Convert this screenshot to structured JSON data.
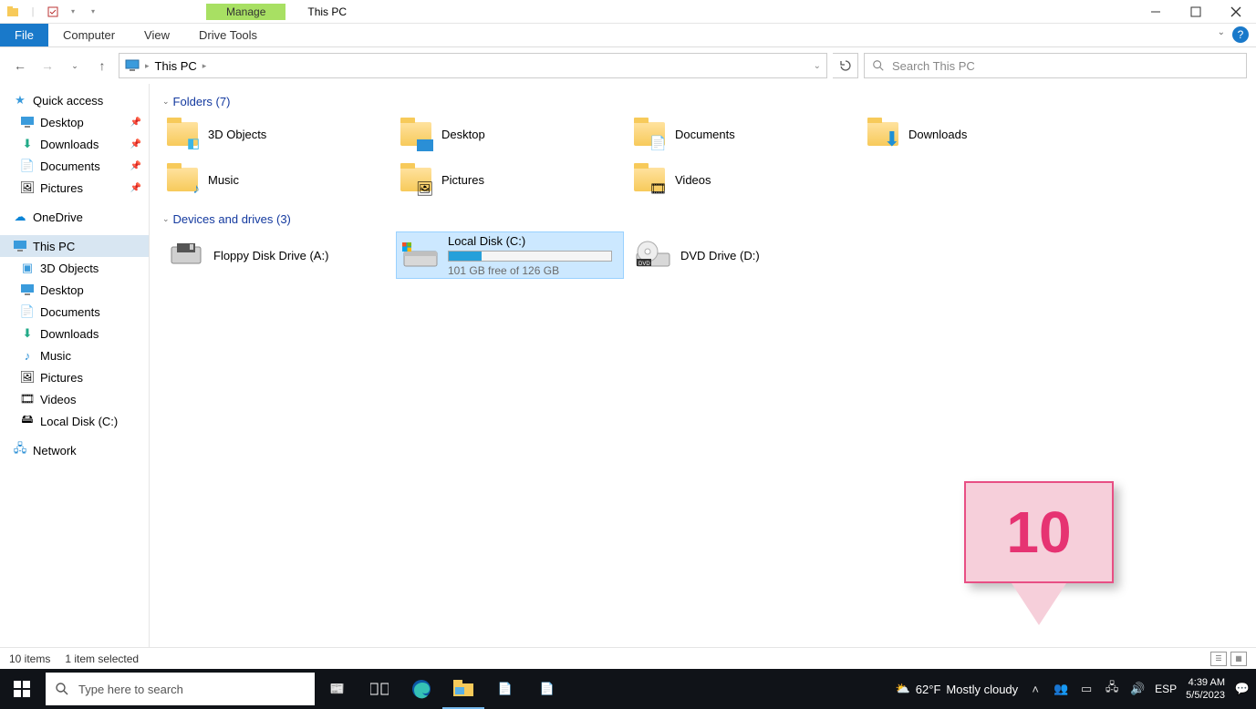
{
  "window": {
    "contextual_tab": "Manage",
    "contextual_group": "Drive Tools",
    "title": "This PC"
  },
  "ribbon": {
    "tabs": {
      "file": "File",
      "computer": "Computer",
      "view": "View",
      "drive_tools": "Drive Tools"
    }
  },
  "breadcrumb": {
    "root": "This PC"
  },
  "search": {
    "placeholder": "Search This PC"
  },
  "sidebar": {
    "quick_access": "Quick access",
    "quick": {
      "desktop": "Desktop",
      "downloads": "Downloads",
      "documents": "Documents",
      "pictures": "Pictures"
    },
    "onedrive": "OneDrive",
    "this_pc": "This PC",
    "pc": {
      "objects3d": "3D Objects",
      "desktop": "Desktop",
      "documents": "Documents",
      "downloads": "Downloads",
      "music": "Music",
      "pictures": "Pictures",
      "videos": "Videos",
      "localdisk": "Local Disk (C:)"
    },
    "network": "Network"
  },
  "groups": {
    "folders": "Folders (7)",
    "drives": "Devices and drives (3)"
  },
  "folders": {
    "objects3d": "3D Objects",
    "desktop": "Desktop",
    "documents": "Documents",
    "downloads": "Downloads",
    "music": "Music",
    "pictures": "Pictures",
    "videos": "Videos"
  },
  "drives": {
    "floppy": "Floppy Disk Drive (A:)",
    "local": {
      "label": "Local Disk (C:)",
      "sub": "101 GB free of 126 GB",
      "fill_pct": 20
    },
    "dvd": "DVD Drive (D:)"
  },
  "status": {
    "items": "10 items",
    "selected": "1 item selected"
  },
  "taskbar": {
    "search_placeholder": "Type here to search",
    "weather_temp": "62°F",
    "weather_desc": "Mostly cloudy",
    "lang": "ESP",
    "time": "4:39 AM",
    "date": "5/5/2023"
  },
  "annotation": {
    "label": "10"
  }
}
